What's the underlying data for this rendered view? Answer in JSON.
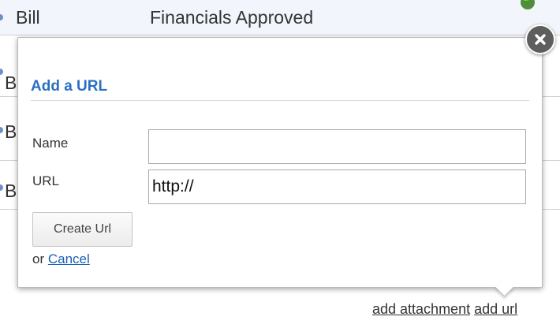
{
  "background": {
    "first_row": {
      "col1": "Bill",
      "col2": "Financials Approved"
    },
    "row_stubs": [
      "B",
      "B",
      "B"
    ]
  },
  "dialog": {
    "title": "Add a URL",
    "fields": {
      "name": {
        "label": "Name",
        "value": ""
      },
      "url": {
        "label": "URL",
        "value": "http://"
      }
    },
    "submit_label": "Create Url",
    "cancel_prefix": "or",
    "cancel_label": "Cancel"
  },
  "bottom_links": {
    "add_attachment": "add attachment",
    "add_url": "add url"
  },
  "colors": {
    "title": "#2b6fc2",
    "link": "#1a5fb4",
    "close_button": "#5e5e5e"
  },
  "icons": {
    "close": "close-icon",
    "row_marker": "row-marker-icon",
    "status": "status-badge-icon"
  }
}
